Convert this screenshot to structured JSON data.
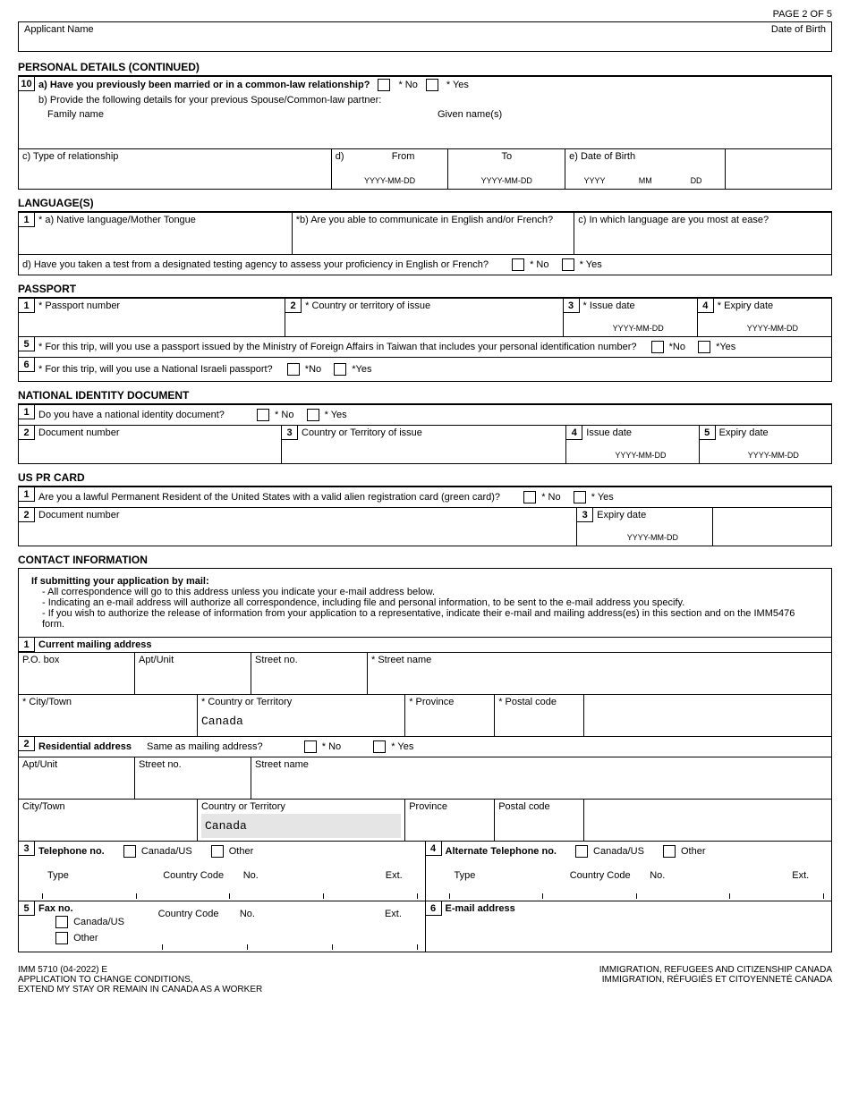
{
  "page": "PAGE 2 OF 5",
  "h": {
    "appName": "Applicant Name",
    "dob": "Date of Birth"
  },
  "s1": {
    "title": "PERSONAL DETAILS (CONTINUED)",
    "q10a": "a) Have you previously been married or in a common-law relationship?",
    "no": "* No",
    "yes": "* Yes",
    "q10b": "b) Provide the following details for your previous Spouse/Common-law partner:",
    "fam": "Family name",
    "given": "Given name(s)",
    "c": "c) Type of relationship",
    "d": "d)",
    "from": "From",
    "to": "To",
    "e": "e) Date of Birth",
    "ymd": "YYYY-MM-DD",
    "y": "YYYY",
    "m": "MM",
    "dd": "DD"
  },
  "s2": {
    "title": "LANGUAGE(S)",
    "a": "* a) Native language/Mother Tongue",
    "b": "*b) Are you able to communicate in English and/or French?",
    "c": "c) In which language are you most at ease?",
    "d": "d) Have you taken a test from a designated testing agency to assess your proficiency in English or French?",
    "no": "* No",
    "yes": "* Yes"
  },
  "s3": {
    "title": "PASSPORT",
    "pn": "* Passport number",
    "ct": "* Country or territory of issue",
    "id": "* Issue date",
    "ed": "* Expiry date",
    "ymd": "YYYY-MM-DD",
    "q5": "* For this trip, will you use a passport issued by the Ministry of Foreign Affairs in Taiwan that includes your personal identification number?",
    "q6": "* For this trip, will you use a National Israeli passport?",
    "no": "*No",
    "yes": "*Yes"
  },
  "s4": {
    "title": "NATIONAL IDENTITY DOCUMENT",
    "q1": "Do you have a national identity document?",
    "no": "* No",
    "yes": "* Yes",
    "dn": "Document number",
    "ct": "Country or Territory of issue",
    "id": "Issue date",
    "ed": "Expiry date",
    "ymd": "YYYY-MM-DD"
  },
  "s5": {
    "title": "US PR CARD",
    "q1": "Are you a lawful Permanent Resident of the United States with a valid alien registration card (green card)?",
    "no": "* No",
    "yes": "* Yes",
    "dn": "Document number",
    "ed": "Expiry date",
    "ymd": "YYYY-MM-DD"
  },
  "s6": {
    "title": "CONTACT INFORMATION",
    "mailHdr": "If submitting your application by mail:",
    "l1": "All correspondence will go to this address unless you indicate your e-mail address below.",
    "l2": "Indicating an e-mail address will authorize all correspondence, including file and personal information, to be sent to the e-mail address you specify.",
    "l3": "If you wish to authorize the release of information from your application to a representative, indicate their e-mail and mailing address(es) in this section and on the IMM5476 form.",
    "cma": "Current mailing address",
    "po": "P.O. box",
    "apt": "Apt/Unit",
    "sno": "Street no.",
    "sname": "* Street name",
    "snameR": "Street name",
    "city": "* City/Town",
    "cityR": "City/Town",
    "cot": "* Country or Territory",
    "cotR": "Country or Territory",
    "canada": "Canada",
    "prov": "* Province",
    "provR": "Province",
    "pc": "* Postal code",
    "pcR": "Postal code",
    "res": "Residential address",
    "same": "Same as mailing address?",
    "no": "* No",
    "yes": "* Yes",
    "tel": "Telephone no.",
    "atel": "Alternate Telephone no.",
    "fax": "Fax no.",
    "email": "E-mail address",
    "caus": "Canada/US",
    "other": "Other",
    "type": "Type",
    "cc": "Country Code",
    "num": "No.",
    "ext": "Ext."
  },
  "f": {
    "code": "IMM 5710 (04-2022) E",
    "l1": "APPLICATION TO CHANGE CONDITIONS,",
    "l2": "EXTEND MY STAY OR REMAIN IN CANADA AS A WORKER",
    "r1": "IMMIGRATION, REFUGEES AND CITIZENSHIP CANADA",
    "r2": "IMMIGRATION, RÉFUGIÉS ET CITOYENNETÉ CANADA"
  }
}
